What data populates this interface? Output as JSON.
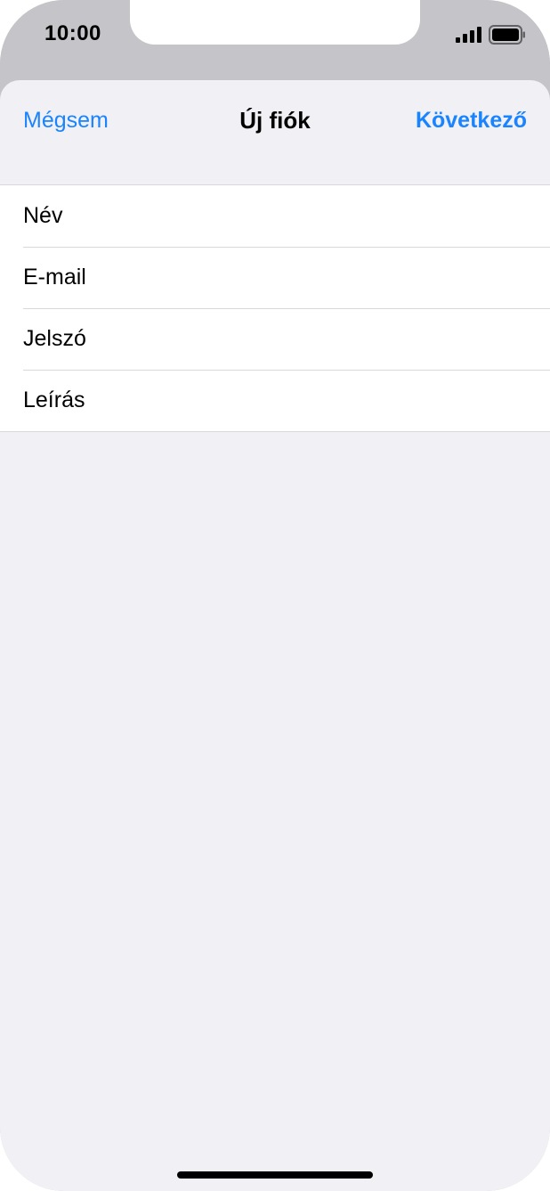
{
  "status_bar": {
    "time": "10:00",
    "signal_icon": "cellular-signal-icon",
    "battery_icon": "battery-icon"
  },
  "nav": {
    "cancel_label": "Mégsem",
    "title": "Új fiók",
    "next_label": "Következő",
    "accent_color": "#1a84ff"
  },
  "form": {
    "fields": [
      {
        "label": "Név"
      },
      {
        "label": "E-mail"
      },
      {
        "label": "Jelszó"
      },
      {
        "label": "Leírás"
      }
    ]
  }
}
